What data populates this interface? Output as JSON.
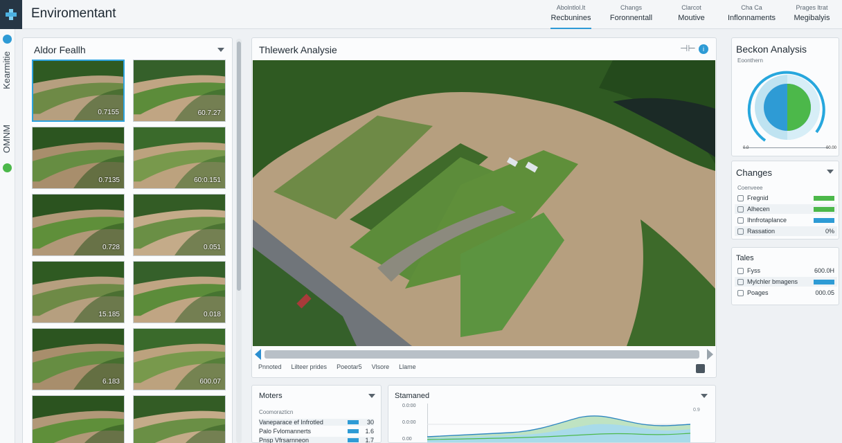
{
  "app": {
    "title": "Enviromentant"
  },
  "topnav": [
    {
      "sub": "Abolntlol.lt",
      "label": "Recbunines",
      "active": true
    },
    {
      "sub": "Changs",
      "label": "Foronnentall",
      "active": false
    },
    {
      "sub": "Clarcot",
      "label": "Moutive",
      "active": false
    },
    {
      "sub": "Cha Ca",
      "label": "Inflonnaments",
      "active": false
    },
    {
      "sub": "Prages ltrat",
      "label": "Megibalyis",
      "active": false
    }
  ],
  "rail": {
    "text_top": "Kearmitie",
    "text_bottom": "OMNM"
  },
  "gallery": {
    "title": "Aldor Feallh",
    "thumbs": [
      {
        "label": "0.7155",
        "selected": true
      },
      {
        "label": "60.7.27"
      },
      {
        "label": "0.7135"
      },
      {
        "label": "60:0.151"
      },
      {
        "label": "0.728"
      },
      {
        "label": "0.051"
      },
      {
        "label": "15.185"
      },
      {
        "label": "0.018"
      },
      {
        "label": "6.183"
      },
      {
        "label": "600.07"
      },
      {
        "label": ""
      },
      {
        "label": ""
      }
    ]
  },
  "viewer": {
    "title": "Thlewerk Analysie",
    "tabs": [
      "Pnnoted",
      "Lilteer prides",
      "Poeotar5",
      "Vlsore",
      "Llame"
    ]
  },
  "beckon": {
    "title": "Beckon Analysis",
    "subtitle": "Eoonthern",
    "axis_left": "0.0",
    "axis_right": "00.00",
    "colors": {
      "outer_ring": "#27a7dd",
      "green": "#4cb84a",
      "blue": "#2e9bd5",
      "pale": "#bfe3f1"
    }
  },
  "changes": {
    "title": "Changes",
    "subtitle": "Coenveee",
    "rows": [
      {
        "label": "Fregnid",
        "color": "#4cb84a"
      },
      {
        "label": "Alhecen",
        "color": "#4cb84a"
      },
      {
        "label": "Ihnfrotaplance",
        "color": "#2e9bd5"
      },
      {
        "label": "Rassation",
        "value": "0%"
      }
    ]
  },
  "tales": {
    "title": "Tales",
    "rows": [
      {
        "label": "Fyss",
        "value": "600.0H"
      },
      {
        "label": "Mylchler bmagens",
        "color": "#2e9bd5"
      },
      {
        "label": "Poages",
        "value": "000.05"
      }
    ]
  },
  "moters": {
    "title": "Moters",
    "subtitle": "Coomorazticn",
    "rows": [
      {
        "label": "Vaneparace ef Infrotled",
        "value": "30"
      },
      {
        "label": "Palo Fvlomannerts",
        "value": "1.6"
      },
      {
        "label": "Pnsp Vfrsarnneon",
        "value": "1.7"
      }
    ]
  },
  "stamaned": {
    "title": "Stamaned",
    "y_top": "0.9",
    "y_labels": [
      "0.0:00",
      "0.0:00",
      "0.00"
    ]
  }
}
